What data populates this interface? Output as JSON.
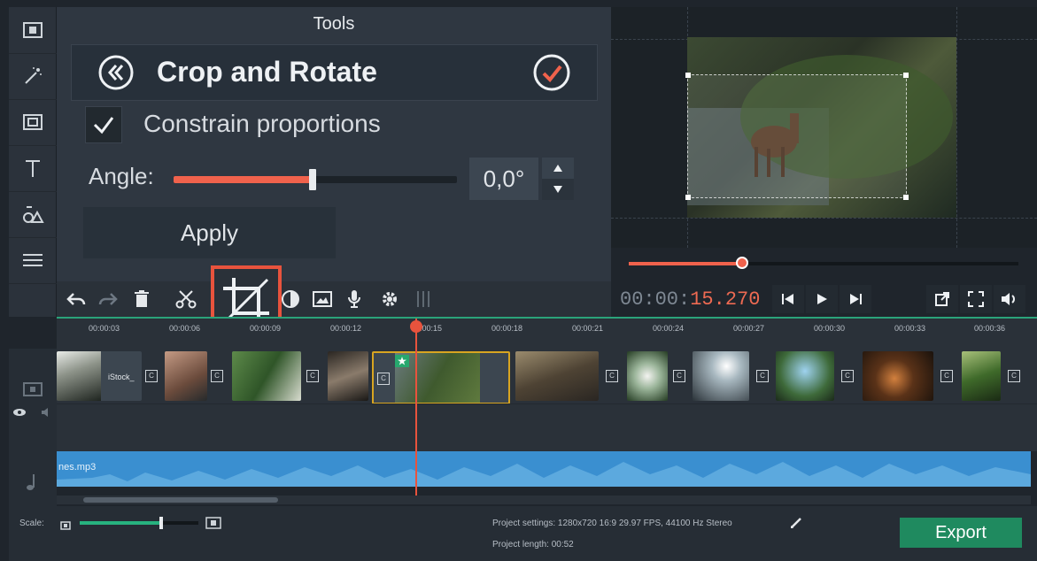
{
  "tools_panel": {
    "title": "Tools",
    "crop_title": "Crop and Rotate",
    "constrain_label": "Constrain proportions",
    "constrain_checked": true,
    "angle_label": "Angle:",
    "angle_value": "0,0°",
    "angle_slider_fraction": 0.49,
    "apply_label": "Apply"
  },
  "player": {
    "timecode_prefix": "00:00:",
    "timecode_seconds": "15.270",
    "position_fraction": 0.29
  },
  "timeline": {
    "ticks": [
      "00:00:03",
      "00:00:06",
      "00:00:09",
      "00:00:12",
      "00:00:15",
      "00:00:18",
      "00:00:21",
      "00:00:24",
      "00:00:27",
      "00:00:30",
      "00:00:33",
      "00:00:36"
    ],
    "first_clip_label": "iStock_",
    "audio_label": "nes.mp3"
  },
  "footer": {
    "scale_label": "Scale:",
    "scale_fraction": 0.68,
    "project_settings": "Project settings:  1280x720 16:9 29.97 FPS, 44100 Hz Stereo",
    "project_length": "Project length:    00:52",
    "export_label": "Export"
  },
  "colors": {
    "accent": "#f0624c",
    "export": "#1f8a5f",
    "audio": "#3a8fd0",
    "timeline_green": "#2aa37a"
  }
}
